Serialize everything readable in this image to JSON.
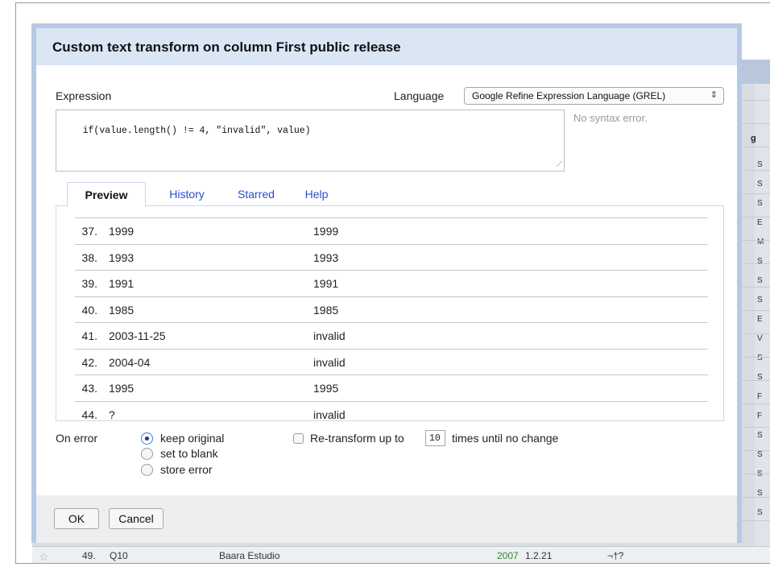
{
  "dialog": {
    "title": "Custom text transform on column First public release",
    "expression_label": "Expression",
    "language_label": "Language",
    "language_value": "Google Refine Expression Language (GREL)",
    "expression": "if(value.length() != 4, \"invalid\", value)",
    "syntax_status": "No syntax error.",
    "tabs": [
      {
        "label": "Preview"
      },
      {
        "label": "History"
      },
      {
        "label": "Starred"
      },
      {
        "label": "Help"
      }
    ],
    "preview_rows": [
      {
        "index": "37.",
        "original": "1999",
        "result": "1999"
      },
      {
        "index": "38.",
        "original": "1993",
        "result": "1993"
      },
      {
        "index": "39.",
        "original": "1991",
        "result": "1991"
      },
      {
        "index": "40.",
        "original": "1985",
        "result": "1985"
      },
      {
        "index": "41.",
        "original": "2003-11-25",
        "result": "invalid"
      },
      {
        "index": "42.",
        "original": "2004-04",
        "result": "invalid"
      },
      {
        "index": "43.",
        "original": "1995",
        "result": "1995"
      },
      {
        "index": "44.",
        "original": "?",
        "result": "invalid"
      }
    ],
    "on_error": {
      "label": "On error",
      "options": [
        {
          "label": "keep original",
          "checked": true
        },
        {
          "label": "set to blank",
          "checked": false
        },
        {
          "label": "store error",
          "checked": false
        }
      ]
    },
    "retransform": {
      "pre_label": "Re-transform up to",
      "value": "10",
      "post_label": "times until no change",
      "checked": false
    },
    "buttons": {
      "ok": "OK",
      "cancel": "Cancel"
    }
  },
  "background": {
    "header_fragment": "g",
    "right_letters": [
      "S",
      "S",
      "S",
      "E",
      "M",
      "S",
      "S",
      "S",
      "E",
      "V",
      "S",
      "S",
      "F",
      "F",
      "S",
      "S",
      "S",
      "S",
      "S"
    ],
    "bottom_row": {
      "row_number": "49.",
      "name": "Q10",
      "developer": "Baara Estudio",
      "year": "2007",
      "version": "1.2.21",
      "misc": "¬†?"
    }
  }
}
